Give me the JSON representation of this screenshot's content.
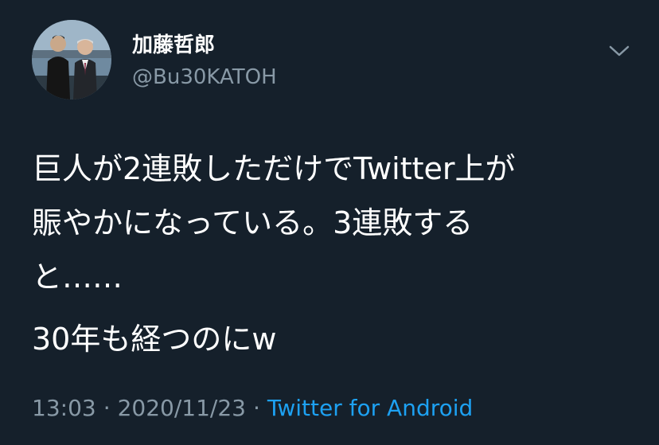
{
  "user": {
    "display_name": "加藤哲郎",
    "handle": "@Bu30KATOH"
  },
  "tweet": {
    "paragraph1": "巨人が2連敗しただけでTwitter上が\n賑やかになっている。3連敗する\nと……",
    "paragraph2": "30年も経つのにw"
  },
  "meta": {
    "time": "13:03",
    "separator": "·",
    "date": "2020/11/23",
    "source": "Twitter for Android"
  },
  "icons": {
    "caret": "chevron-down-icon",
    "avatar": "profile-photo"
  },
  "colors": {
    "background": "#15202b",
    "secondary_text": "#8899a6",
    "link": "#1da1f2"
  }
}
